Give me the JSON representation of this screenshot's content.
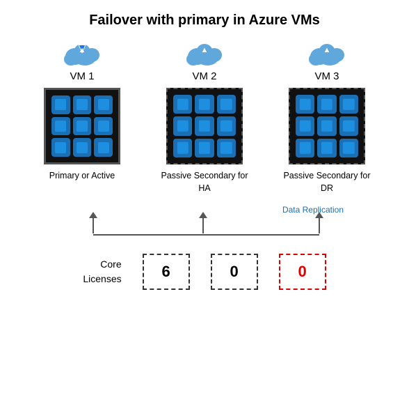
{
  "title": "Failover with primary in Azure VMs",
  "vms": [
    {
      "label": "VM 1",
      "border": "solid",
      "description": "Primary or Active"
    },
    {
      "label": "VM 2",
      "border": "dashed",
      "description": "Passive Secondary for HA"
    },
    {
      "label": "VM 3",
      "border": "dashed",
      "description": "Passive Secondary for DR"
    }
  ],
  "data_replication_label": "Data Replication",
  "licenses_label": "Core\nLicenses",
  "license_values": [
    "6",
    "0",
    "0"
  ],
  "license_styles": [
    "dashed-black",
    "dashed-black",
    "dashed-red"
  ]
}
